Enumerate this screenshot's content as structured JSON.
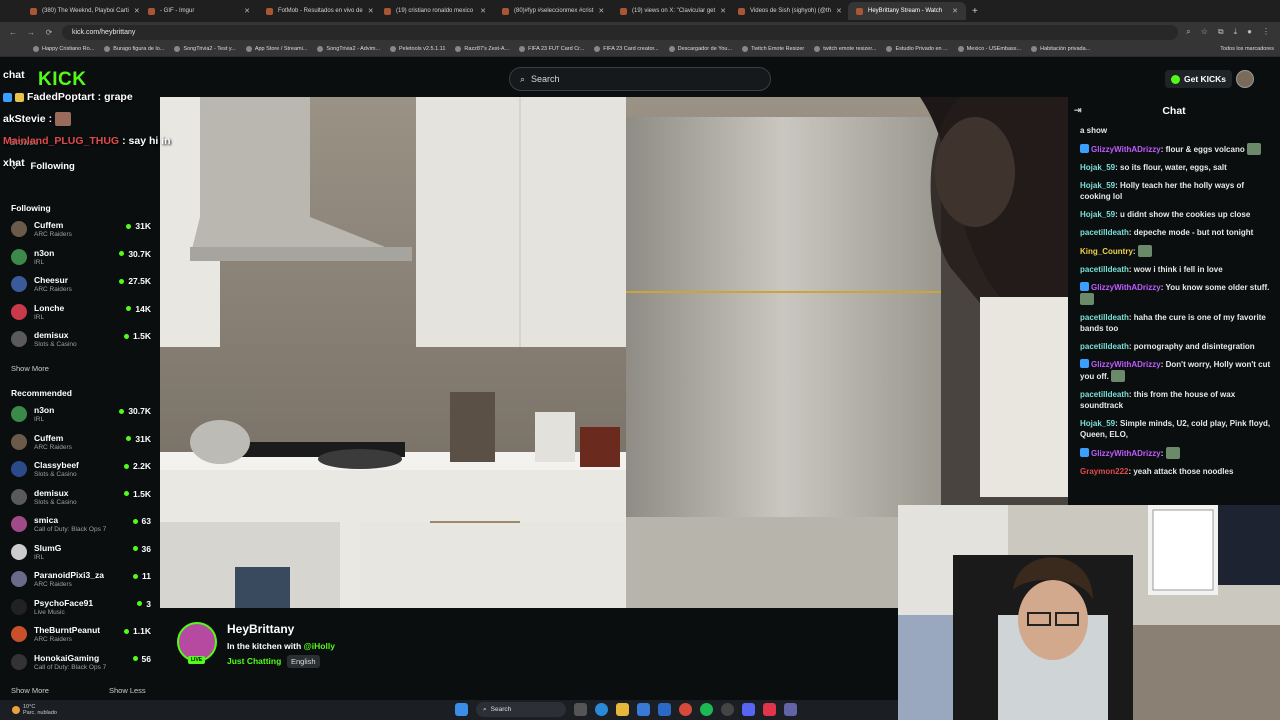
{
  "browser": {
    "tabs": [
      {
        "title": "(380) The Weeknd, Playboi Carti",
        "active": false
      },
      {
        "title": "- GIF - Imgur",
        "active": false
      },
      {
        "title": "FotMob - Resultados en vivo de",
        "active": false
      },
      {
        "title": "(19) cristiano ronaldo mexico",
        "active": false
      },
      {
        "title": "(80)#fyp #seleccionmex #crist",
        "active": false
      },
      {
        "title": "(19) views on X: \"Clavicular get",
        "active": false
      },
      {
        "title": "Videos de Sish (sighyoh) (@th",
        "active": false
      },
      {
        "title": "HeyBrittany Stream - Watch",
        "active": true
      }
    ],
    "url": "kick.com/heybrittany",
    "bookmarks": [
      "Happy Cristiano Ro...",
      "Burago figura de lo...",
      "SongTrivia2 - Test y...",
      "App Store / Streami...",
      "SongTrivia2 - Advim...",
      "Peletools v2.5.1.11",
      "Razz87's Zest-A...",
      "FIFA 23 FUT Card Cr...",
      "FIFA 23 Card creator...",
      "Descargador de You...",
      "Twitch Emote Resizer",
      "twitch emote resizer...",
      "Estudio Privado en ...",
      "Mexico - USEmbass...",
      "Habitación privada..."
    ],
    "bookmarks_all": "Todos los marcadores"
  },
  "header": {
    "logo": "KICK",
    "search_placeholder": "Search",
    "get_kicks": "Get KICKs"
  },
  "overlay_chat": [
    {
      "label": "chat"
    },
    {
      "user": "FadedPoptart",
      "text": ": grape"
    },
    {
      "user": "akStevie",
      "text": ":"
    },
    {
      "user": "Mainland_PLUG_THUG",
      "text": ": say hi in"
    },
    {
      "label": "xhat"
    }
  ],
  "sidebar": {
    "browse": "Browse",
    "following_link": "Following",
    "following_heading": "Following",
    "following": [
      {
        "name": "Cuffem",
        "category": "ARC Raiders",
        "viewers": "31K",
        "color": "#6b5a4a"
      },
      {
        "name": "n3on",
        "category": "IRL",
        "viewers": "30.7K",
        "color": "#3b8a4a"
      },
      {
        "name": "Cheesur",
        "category": "ARC Raiders",
        "viewers": "27.5K",
        "color": "#3a5a9a"
      },
      {
        "name": "Lonche",
        "category": "IRL",
        "viewers": "14K",
        "color": "#c83a4a"
      },
      {
        "name": "demisux",
        "category": "Slots & Casino",
        "viewers": "1.5K",
        "color": "#5a5a5a"
      }
    ],
    "show_more_1": "Show More",
    "recommended_heading": "Recommended",
    "recommended": [
      {
        "name": "n3on",
        "category": "IRL",
        "viewers": "30.7K",
        "color": "#3b8a4a"
      },
      {
        "name": "Cuffem",
        "category": "ARC Raiders",
        "viewers": "31K",
        "color": "#6b5a4a"
      },
      {
        "name": "Classybeef",
        "category": "Slots & Casino",
        "viewers": "2.2K",
        "color": "#2a4a8a"
      },
      {
        "name": "demisux",
        "category": "Slots & Casino",
        "viewers": "1.5K",
        "color": "#5a5a5a"
      },
      {
        "name": "smica",
        "category": "Call of Duty: Black Ops 7",
        "viewers": "63",
        "color": "#a04a8a"
      },
      {
        "name": "SlumG",
        "category": "IRL",
        "viewers": "36",
        "color": "#cccccc"
      },
      {
        "name": "ParanoidPixi3_za",
        "category": "ARC Raiders",
        "viewers": "11",
        "color": "#6a6a8a"
      },
      {
        "name": "PsychoFace91",
        "category": "Live Music",
        "viewers": "3",
        "color": "#222222"
      },
      {
        "name": "TheBurntPeanut",
        "category": "ARC Raiders",
        "viewers": "1.1K",
        "color": "#c8502a"
      },
      {
        "name": "HonokaiGaming",
        "category": "Call of Duty: Black Ops 7",
        "viewers": "56",
        "color": "#333333"
      }
    ],
    "show_more_2": "Show More",
    "show_less": "Show Less"
  },
  "stream": {
    "channel": "HeyBrittany",
    "title_prefix": "In the kitchen with ",
    "mention": "@iHolly",
    "category": "Just Chatting",
    "language": "English",
    "live_badge": "LIVE"
  },
  "chat": {
    "title": "Chat",
    "messages": [
      {
        "user": "",
        "text": "a show",
        "color": "#e8e8e8",
        "badge": false,
        "emote": false
      },
      {
        "user": "GlizzyWithADrizzy",
        "text": "flour & eggs volcano",
        "color": "#c05cff",
        "badge": true,
        "emote": true
      },
      {
        "user": "Hojak_59",
        "text": "so its flour, water, eggs, salt",
        "color": "#7ae0d8",
        "badge": false,
        "emote": false
      },
      {
        "user": "Hojak_59",
        "text": "Holly teach her the holly ways of cooking lol",
        "color": "#7ae0d8",
        "badge": false,
        "emote": false
      },
      {
        "user": "Hojak_59",
        "text": "u didnt show the cookies up close",
        "color": "#7ae0d8",
        "badge": false,
        "emote": false
      },
      {
        "user": "pacetilldeath",
        "text": "depeche mode - but not tonight",
        "color": "#7ae0d8",
        "badge": false,
        "emote": false
      },
      {
        "user": "King_Country",
        "text": "",
        "color": "#f0d24a",
        "badge": false,
        "emote": true
      },
      {
        "user": "pacetilldeath",
        "text": "wow i think i fell in love",
        "color": "#7ae0d8",
        "badge": false,
        "emote": false
      },
      {
        "user": "GlizzyWithADrizzy",
        "text": "You know some older stuff.",
        "color": "#c05cff",
        "badge": true,
        "emote": true
      },
      {
        "user": "pacetilldeath",
        "text": "haha the cure is one of my favorite bands too",
        "color": "#7ae0d8",
        "badge": false,
        "emote": false
      },
      {
        "user": "pacetilldeath",
        "text": "pornography and disintegration",
        "color": "#7ae0d8",
        "badge": false,
        "emote": false
      },
      {
        "user": "GlizzyWithADrizzy",
        "text": "Don't worry, Holly won't cut you off.",
        "color": "#c05cff",
        "badge": true,
        "emote": true
      },
      {
        "user": "pacetilldeath",
        "text": "this from the house of wax soundtrack",
        "color": "#7ae0d8",
        "badge": false,
        "emote": false
      },
      {
        "user": "Hojak_59",
        "text": "Simple minds, U2, cold play, Pink floyd, Queen, ELO,",
        "color": "#7ae0d8",
        "badge": false,
        "emote": false
      },
      {
        "user": "GlizzyWithADrizzy",
        "text": "",
        "color": "#c05cff",
        "badge": true,
        "emote": true
      },
      {
        "user": "Graymon222",
        "text": "yeah attack those noodles",
        "color": "#e04a4a",
        "badge": false,
        "emote": false
      }
    ]
  },
  "taskbar": {
    "weather_temp": "10°C",
    "weather_desc": "Parc. nublado",
    "search": "Search"
  },
  "colors": {
    "kick_green": "#53fc18",
    "background": "#0b0e0f"
  }
}
